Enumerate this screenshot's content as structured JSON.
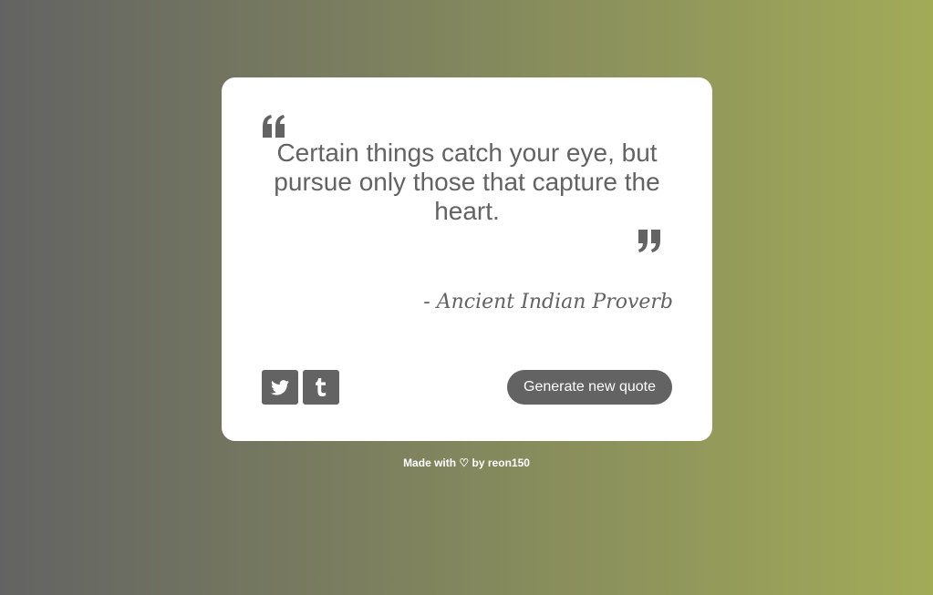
{
  "quote": {
    "text": "Certain things catch your eye, but pursue only those that capture the heart.",
    "author": "- Ancient Indian Proverb"
  },
  "icons": {
    "open_quote": "quote-left-icon",
    "close_quote": "quote-right-icon",
    "twitter": "twitter-icon",
    "tumblr": "tumblr-icon",
    "heart": "heart-icon"
  },
  "actions": {
    "new_quote_label": "Generate new quote"
  },
  "footer": {
    "prefix": "Made with",
    "heart": "♡",
    "by": "by",
    "author_link": "reon150"
  },
  "colors": {
    "accent": "#636363",
    "gradient_start": "#636363",
    "gradient_end": "#a2ab58",
    "card_bg": "#ffffff"
  }
}
